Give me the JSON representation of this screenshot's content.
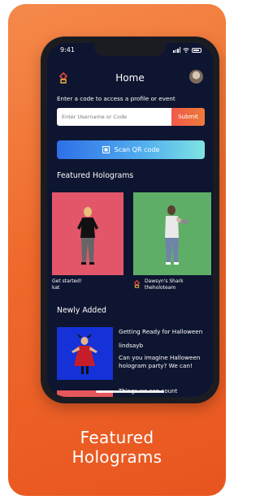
{
  "status": {
    "time": "9:41"
  },
  "header": {
    "title": "Home"
  },
  "code_entry": {
    "prompt": "Enter a code to access a profile or event",
    "placeholder": "Enter Username or Code",
    "submit_label": "Submit"
  },
  "scan": {
    "label": "Scan QR code"
  },
  "featured": {
    "heading": "Featured Holograms",
    "items": [
      {
        "title": "Get started!",
        "user": "kat"
      },
      {
        "title": "Dawsyn's Shark",
        "user": "theholoteam"
      }
    ]
  },
  "newly_added": {
    "heading": "Newly Added",
    "items": [
      {
        "title": "Getting Ready for Halloween",
        "user": "lindsayb",
        "description": "Can you imagine Halloween hologram party? We can!"
      },
      {
        "title": "Things we can count"
      }
    ]
  },
  "caption": {
    "line1": "Featured",
    "line2": "Holograms"
  },
  "colors": {
    "card_gradient_start": "#f58a4a",
    "card_gradient_end": "#e8551f",
    "app_background": "#0e1530",
    "submit_button": "#f05a4a",
    "scan_button_start": "#2f6fe8",
    "scan_button_end": "#7fe3e2",
    "featured_card_1": "#e3566a",
    "featured_card_2": "#5fae67",
    "new_thumb": "#1531d8"
  },
  "icons": [
    "holo-logo-icon",
    "qr-scan-icon",
    "signal-icon",
    "wifi-icon",
    "battery-icon",
    "avatar"
  ]
}
